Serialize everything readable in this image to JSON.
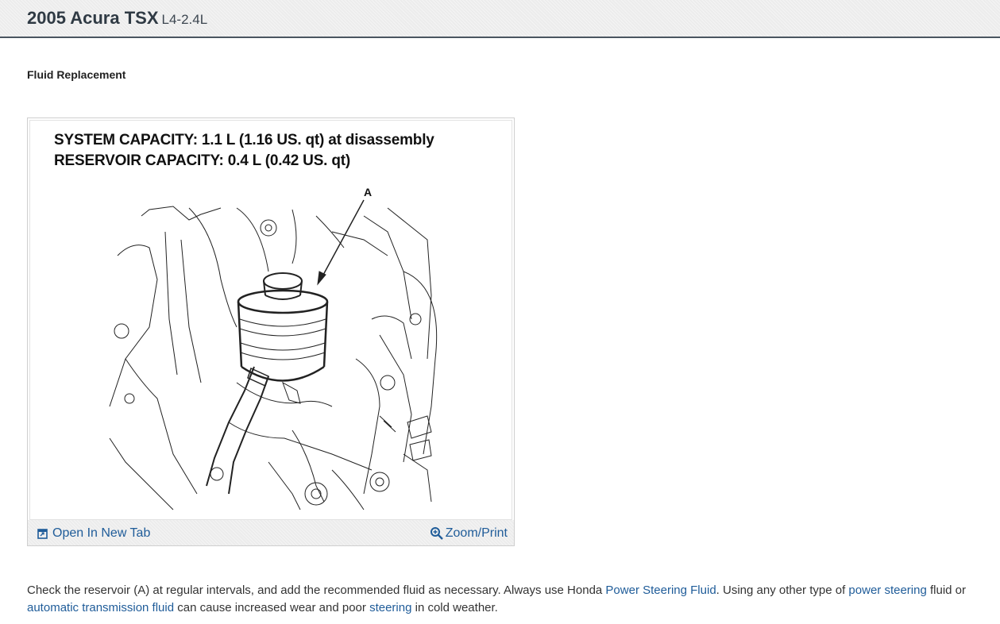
{
  "header": {
    "title": "2005 Acura TSX",
    "engine": "L4-2.4L"
  },
  "section": {
    "title": "Fluid Replacement"
  },
  "figure": {
    "capacity_line1": "SYSTEM CAPACITY:  1.1 L (1.16 US. qt) at disassembly",
    "capacity_line2": "RESERVOIR CAPACITY:    0.4 L (0.42 US. qt)",
    "callout_label": "A",
    "open_tab_label": "Open In New Tab",
    "zoom_label": "Zoom/Print",
    "open_tab_icon": "open-in-new-tab-icon",
    "zoom_icon": "magnifier-zoom-icon"
  },
  "paragraph": {
    "seg1": " Check the reservoir (A) at regular intervals, and add the recommended fluid as necessary. Always use Honda ",
    "link1": "Power Steering Fluid",
    "seg2": ". Using any other type of ",
    "link2": "power steering",
    "seg3": " fluid or ",
    "link3": "automatic transmission fluid",
    "seg4": " can cause increased wear and poor ",
    "link4": "steering",
    "seg5": " in cold weather."
  },
  "colors": {
    "link": "#1f5c99",
    "header_border": "#4a5560",
    "text": "#333333"
  }
}
